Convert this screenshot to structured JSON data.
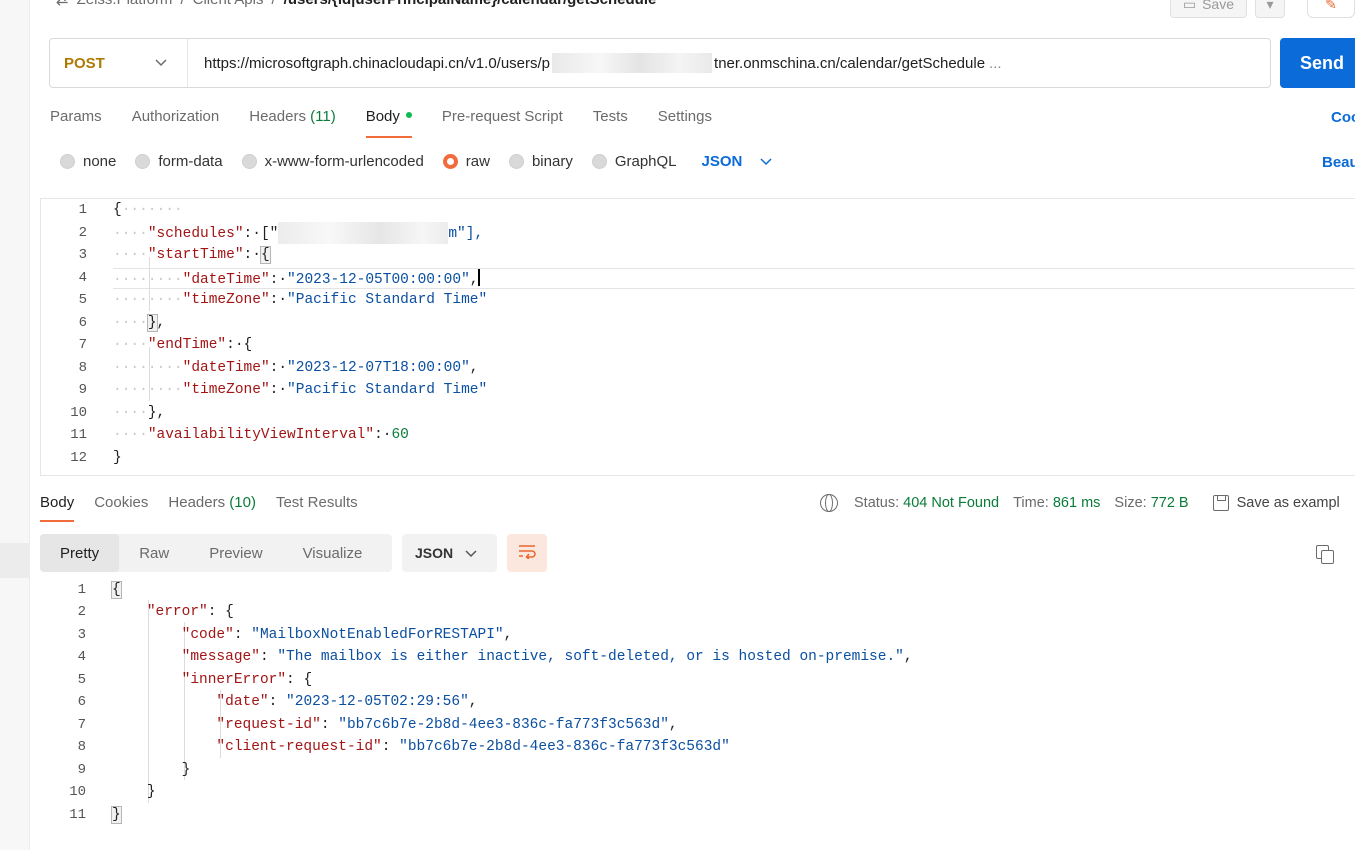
{
  "breadcrumb": {
    "items": [
      "Zeiss.Platform",
      "Client Apis"
    ],
    "separator": "/",
    "current": "/users/{id|userPrincipalName}/calendar/getSchedule"
  },
  "toolbar": {
    "save_label": "Save"
  },
  "request": {
    "method": "POST",
    "url_prefix": "https://microsoftgraph.chinacloudapi.cn/v1.0/users/p",
    "url_suffix": "tner.onmschina.cn/calendar/getSchedule",
    "url_ellipsis": "...",
    "send_label": "Send"
  },
  "request_tabs": [
    {
      "label": "Params"
    },
    {
      "label": "Authorization"
    },
    {
      "label": "Headers",
      "count": "(11)"
    },
    {
      "label": "Body",
      "active": true
    },
    {
      "label": "Pre-request Script"
    },
    {
      "label": "Tests"
    },
    {
      "label": "Settings"
    }
  ],
  "code_link": "Coo",
  "body_modes": {
    "options": [
      "none",
      "form-data",
      "x-www-form-urlencoded",
      "raw",
      "binary",
      "GraphQL"
    ],
    "selected": "raw",
    "format": "JSON",
    "beautify_label": "Beau"
  },
  "request_body": {
    "line_numbers": [
      "1",
      "2",
      "3",
      "4",
      "5",
      "6",
      "7",
      "8",
      "9",
      "10",
      "11",
      "12"
    ],
    "keys": {
      "schedules": "\"schedules\"",
      "startTime": "\"startTime\"",
      "dateTime": "\"dateTime\"",
      "timeZone": "\"timeZone\"",
      "endTime": "\"endTime\"",
      "availabilityViewInterval": "\"availabilityViewInterval\""
    },
    "values": {
      "schedules_open": "[\"",
      "schedules_tail": "m\"],",
      "start_dateTime": "\"2023-12-05T00:00:00\"",
      "start_timeZone": "\"Pacific Standard Time\"",
      "end_dateTime": "\"2023-12-07T18:00:00\"",
      "end_timeZone": "\"Pacific Standard Time\"",
      "interval": "60"
    }
  },
  "response_tabs": [
    {
      "label": "Body",
      "active": true
    },
    {
      "label": "Cookies"
    },
    {
      "label": "Headers",
      "count": "(10)"
    },
    {
      "label": "Test Results"
    }
  ],
  "response_meta": {
    "status_label": "Status:",
    "status_value": "404 Not Found",
    "time_label": "Time:",
    "time_value": "861 ms",
    "size_label": "Size:",
    "size_value": "772 B",
    "save_example": "Save as exampl"
  },
  "response_view": {
    "modes": [
      "Pretty",
      "Raw",
      "Preview",
      "Visualize"
    ],
    "active": "Pretty",
    "format": "JSON"
  },
  "response_body": {
    "line_numbers": [
      "1",
      "2",
      "3",
      "4",
      "5",
      "6",
      "7",
      "8",
      "9",
      "10",
      "11"
    ],
    "keys": {
      "error": "\"error\"",
      "code": "\"code\"",
      "message": "\"message\"",
      "innerError": "\"innerError\"",
      "date": "\"date\"",
      "request_id": "\"request-id\"",
      "client_request_id": "\"client-request-id\""
    },
    "values": {
      "code": "\"MailboxNotEnabledForRESTAPI\"",
      "message": "\"The mailbox is either inactive, soft-deleted, or is hosted on-premise.\"",
      "date": "\"2023-12-05T02:29:56\"",
      "request_id": "\"bb7c6b7e-2b8d-4ee3-836c-fa773f3c563d\"",
      "client_request_id": "\"bb7c6b7e-2b8d-4ee3-836c-fa773f3c563d\""
    }
  },
  "colors": {
    "accent": "#f26b3a",
    "send": "#0b6bd8",
    "method": "#ad7a03",
    "success": "#0a7c3a"
  }
}
